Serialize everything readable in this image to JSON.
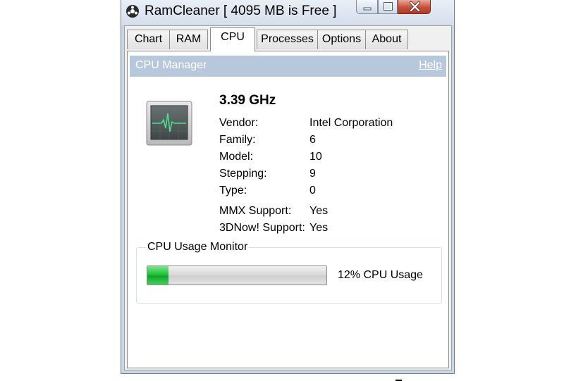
{
  "window": {
    "title": "RamCleaner [ 4095 MB is Free ]",
    "icon": "app-icon"
  },
  "tabs": [
    {
      "label": "Chart"
    },
    {
      "label": "RAM"
    },
    {
      "label": "CPU",
      "active": true
    },
    {
      "label": "Processes"
    },
    {
      "label": "Options"
    },
    {
      "label": "About"
    }
  ],
  "header": {
    "title": "CPU Manager",
    "help": "Help"
  },
  "cpu": {
    "icon": "cpu-monitor-icon",
    "frequency": "3.39 GHz",
    "rows": [
      {
        "label": "Vendor:",
        "value": "Intel Corporation"
      },
      {
        "label": "Family:",
        "value": "6"
      },
      {
        "label": "Model:",
        "value": "10"
      },
      {
        "label": "Stepping:",
        "value": "9"
      },
      {
        "label": "Type:",
        "value": "0"
      },
      {
        "label": "MMX Support:",
        "value": "Yes"
      },
      {
        "label": "3DNow! Support:",
        "value": "Yes"
      }
    ]
  },
  "monitor": {
    "title": "CPU Usage Monitor",
    "usage_percent": 12,
    "usage_text": "12% CPU Usage"
  },
  "colors": {
    "accent_header": "#b7c8dc",
    "progress_green": "#1fc23a",
    "close_button": "#c7503a"
  }
}
